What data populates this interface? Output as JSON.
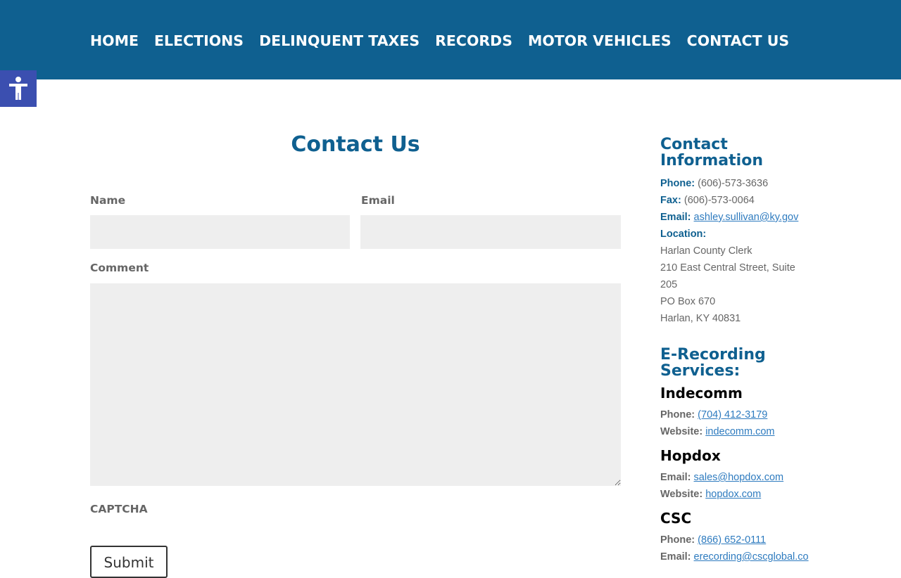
{
  "nav": {
    "items": [
      "HOME",
      "ELECTIONS",
      "DELINQUENT TAXES",
      "RECORDS",
      "MOTOR VEHICLES",
      "CONTACT US"
    ]
  },
  "accessibility": {
    "icon": "accessibility-person-icon"
  },
  "main": {
    "title": "Contact Us",
    "form": {
      "name_label": "Name",
      "name_value": "",
      "email_label": "Email",
      "email_value": "",
      "comment_label": "Comment",
      "comment_value": "",
      "captcha_label": "CAPTCHA",
      "submit_label": "Submit"
    }
  },
  "sidebar": {
    "contact_heading_1": "Contact",
    "contact_heading_2": "Information",
    "phone_label": "Phone:",
    "phone_value": "(606)-573-3636",
    "fax_label": "Fax:",
    "fax_value": "(606)-573-0064",
    "email_label": "Email:",
    "email_value": "ashley.sullivan@ky.gov",
    "location_label": "Location:",
    "address_lines": [
      "Harlan County Clerk",
      "210 East Central Street, Suite",
      "205",
      "PO Box 670",
      "Harlan, KY 40831"
    ],
    "erec_heading_1": "E-Recording",
    "erec_heading_2": "Services:",
    "vendors": [
      {
        "name": "Indecomm",
        "l1": "Phone:",
        "v1": "(704) 412-3179",
        "l2": "Website:",
        "v2": "indecomm.com"
      },
      {
        "name": "Hopdox",
        "l1": "Email:",
        "v1": "sales@hopdox.com",
        "l2": "Website:",
        "v2": "hopdox.com"
      },
      {
        "name": "CSC",
        "l1": "Phone:",
        "v1": "(866) 652-0111",
        "l2": "Email:",
        "v2": "erecording@cscglobal.co"
      }
    ]
  },
  "colors": {
    "brand": "#0f6090",
    "a11y": "#3b4fb0",
    "link": "#2e7bbf",
    "field": "#eeeeee"
  }
}
